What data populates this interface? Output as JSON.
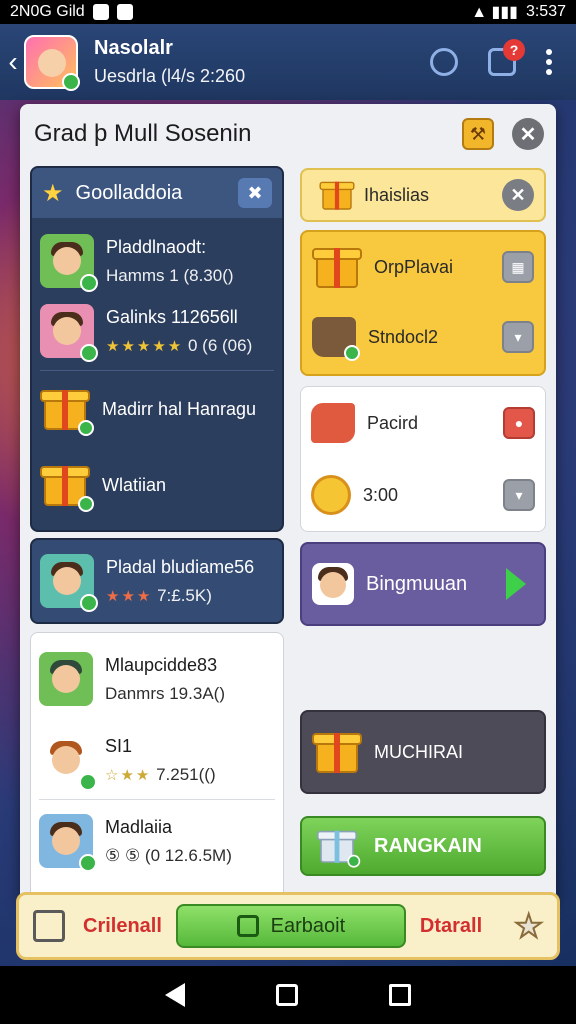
{
  "statusbar": {
    "left_text": "2N0G Gild",
    "time": "3:537"
  },
  "header": {
    "title": "Nasolalr",
    "subtitle": "Uesdrla (l4/s 2:260",
    "notification_count": "?"
  },
  "dialog": {
    "title": "Grad þ Mull Sosenin",
    "left": {
      "section_label": "Goolladdoia",
      "dark_items": [
        {
          "title": "Pladdlnaodt:",
          "sub": "Hamms 1 (8.30()"
        },
        {
          "title": "Galinks 112656ll",
          "sub": "0 (6 (06)"
        },
        {
          "title": "Madirr hal Hanragu"
        },
        {
          "title": "Wlatiian"
        }
      ],
      "promo": {
        "title": "Pladal bludiame56",
        "sub": "7:£.5K)"
      },
      "light_items": [
        {
          "title": "Mlaupcidde83",
          "sub": "Danmrs 19.3A()"
        },
        {
          "title": "SI1",
          "sub": "7.251(()"
        },
        {
          "title": "Madlaiia",
          "sub": "⑤ ⑤ (0 12.6.5M)"
        }
      ]
    },
    "right": {
      "header_label": "Ihaislias",
      "yellow_items": [
        {
          "label": "OrpPlavai"
        },
        {
          "label": "Stndocl2"
        }
      ],
      "white_items": [
        {
          "label": "Pacird"
        },
        {
          "label": "3:00"
        }
      ],
      "purple_label": "Bingmuuan",
      "dark_label": "MUCHIRAI",
      "green_label": "RANGKAIN"
    }
  },
  "bottombar": {
    "left_label": "Crilenall",
    "mid_label": "Earbaoit",
    "right_label": "Dtarall"
  },
  "colors": {
    "header": "#2a4677",
    "accent_yellow": "#f8c93e",
    "green": "#56b93a",
    "purple": "#6a5d9f"
  }
}
